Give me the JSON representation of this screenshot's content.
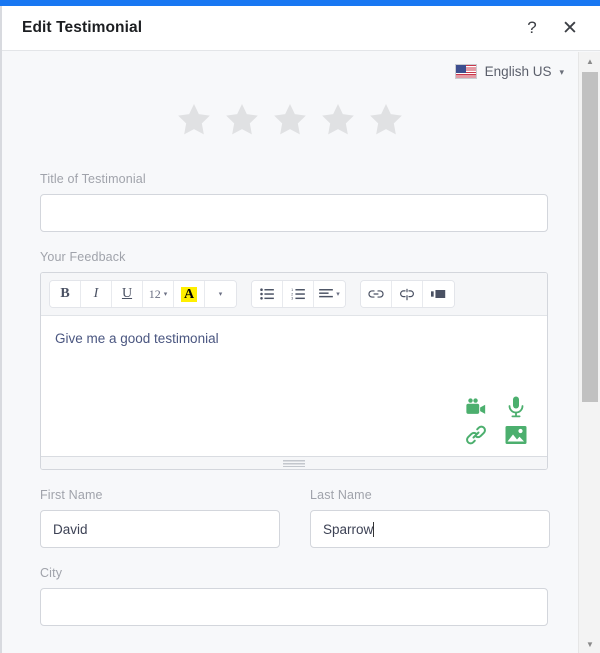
{
  "window": {
    "accent_color": "#1877f2",
    "title": "Edit Testimonial",
    "help_label": "?",
    "close_label": "✕"
  },
  "language": {
    "flag_icon": "us-flag-icon",
    "label": "English US",
    "chevron": "▾"
  },
  "rating": {
    "max": 5,
    "value": 0,
    "empty_color": "#e0e1e3"
  },
  "form": {
    "title_field": {
      "label": "Title of Testimonial",
      "value": "",
      "placeholder": ""
    },
    "feedback_field": {
      "label": "Your Feedback",
      "content": "Give me a good testimonial"
    },
    "first_name_field": {
      "label": "First Name",
      "value": "David",
      "placeholder": ""
    },
    "last_name_field": {
      "label": "Last Name",
      "value": "Sparrow",
      "placeholder": "",
      "has_cursor": true
    },
    "city_field": {
      "label": "City",
      "value": "",
      "placeholder": ""
    }
  },
  "editor_toolbar": {
    "groups": [
      {
        "buttons": [
          {
            "name": "bold-button",
            "label": "B",
            "style": "tb-bold"
          },
          {
            "name": "italic-button",
            "label": "I",
            "style": "tb-italic"
          },
          {
            "name": "underline-button",
            "label": "U",
            "style": "tb-under"
          },
          {
            "name": "font-size-button",
            "label": "12",
            "style": "tb-size",
            "caret": "▾"
          },
          {
            "name": "text-highlight-button",
            "label": "A",
            "style": "hl-a"
          },
          {
            "name": "text-color-dropdown-button",
            "label": "",
            "caret": "▾"
          }
        ]
      },
      {
        "buttons": [
          {
            "name": "bullet-list-button",
            "icon": "unordered-list-icon"
          },
          {
            "name": "numbered-list-button",
            "icon": "ordered-list-icon"
          },
          {
            "name": "align-button",
            "icon": "align-left-icon",
            "caret": "▾"
          }
        ]
      },
      {
        "buttons": [
          {
            "name": "insert-link-button",
            "icon": "link-icon"
          },
          {
            "name": "remove-link-button",
            "icon": "unlink-icon"
          },
          {
            "name": "insert-media-button",
            "icon": "media-insert-icon"
          }
        ]
      }
    ]
  },
  "media_icons": {
    "color": "#4caf6e",
    "items": [
      {
        "name": "record-video-icon",
        "label": "video-camera-icon"
      },
      {
        "name": "record-audio-icon",
        "label": "microphone-icon"
      },
      {
        "name": "attach-link-icon",
        "label": "link-icon"
      },
      {
        "name": "attach-image-icon",
        "label": "image-icon"
      }
    ]
  },
  "scrollbar": {
    "up_arrow": "▲",
    "down_arrow": "▼",
    "thumb_color": "#c1c1c1"
  }
}
